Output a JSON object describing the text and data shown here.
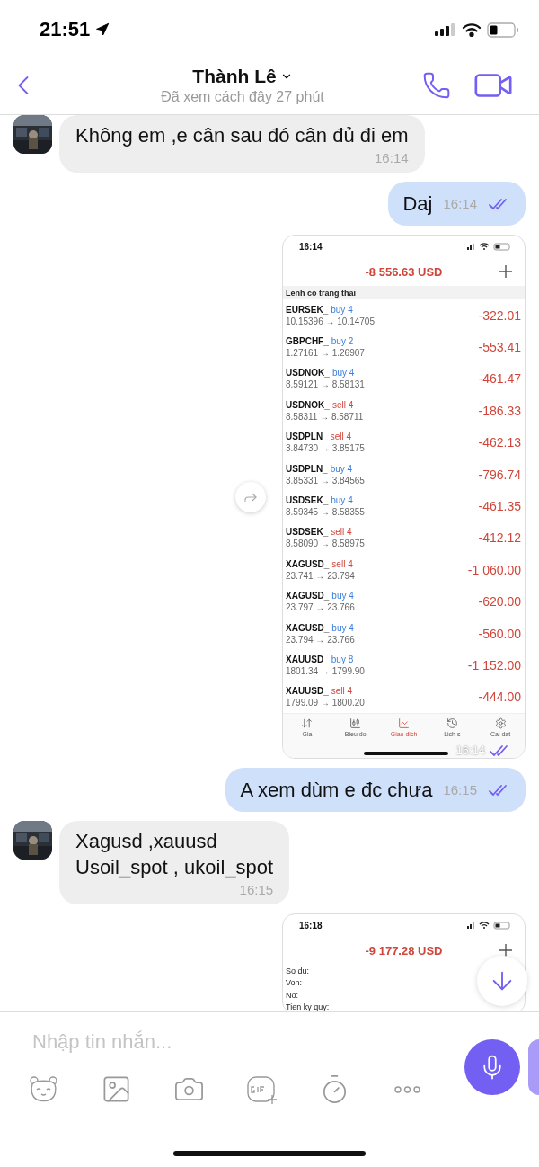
{
  "status_bar": {
    "time": "21:51"
  },
  "header": {
    "title": "Thành Lê",
    "subtitle": "Đã xem cách đây 27 phút"
  },
  "messages": [
    {
      "kind": "text",
      "incoming": true,
      "text": "Không em ,e cân sau đó cân đủ đi em",
      "time": "16:14"
    },
    {
      "kind": "text",
      "incoming": false,
      "text": "Daj",
      "time": "16:14",
      "read": true
    },
    {
      "kind": "screenshot",
      "incoming": false,
      "time": "16:14",
      "read": true,
      "share_button": true,
      "shot": {
        "time": "16:14",
        "balance": "-8 556.63 USD",
        "section": "Lenh co trang thai",
        "positions": [
          {
            "symbol": "EURSEK_",
            "order": "buy 4",
            "kind": "buy",
            "range": "10.15396 → 10.14705",
            "profit": "-322.01"
          },
          {
            "symbol": "GBPCHF_",
            "order": "buy 2",
            "kind": "buy",
            "range": "1.27161 → 1.26907",
            "profit": "-553.41"
          },
          {
            "symbol": "USDNOK_",
            "order": "buy 4",
            "kind": "buy",
            "range": "8.59121 → 8.58131",
            "profit": "-461.47"
          },
          {
            "symbol": "USDNOK_",
            "order": "sell 4",
            "kind": "sell",
            "range": "8.58311 → 8.58711",
            "profit": "-186.33"
          },
          {
            "symbol": "USDPLN_",
            "order": "sell 4",
            "kind": "sell",
            "range": "3.84730 → 3.85175",
            "profit": "-462.13"
          },
          {
            "symbol": "USDPLN_",
            "order": "buy 4",
            "kind": "buy",
            "range": "3.85331 → 3.84565",
            "profit": "-796.74"
          },
          {
            "symbol": "USDSEK_",
            "order": "buy 4",
            "kind": "buy",
            "range": "8.59345 → 8.58355",
            "profit": "-461.35"
          },
          {
            "symbol": "USDSEK_",
            "order": "sell 4",
            "kind": "sell",
            "range": "8.58090 → 8.58975",
            "profit": "-412.12"
          },
          {
            "symbol": "XAGUSD_",
            "order": "sell 4",
            "kind": "sell",
            "range": "23.741 → 23.794",
            "profit": "-1 060.00"
          },
          {
            "symbol": "XAGUSD_",
            "order": "buy 4",
            "kind": "buy",
            "range": "23.797 → 23.766",
            "profit": "-620.00"
          },
          {
            "symbol": "XAGUSD_",
            "order": "buy 4",
            "kind": "buy",
            "range": "23.794 → 23.766",
            "profit": "-560.00"
          },
          {
            "symbol": "XAUUSD_",
            "order": "buy 8",
            "kind": "buy",
            "range": "1801.34 → 1799.90",
            "profit": "-1 152.00"
          },
          {
            "symbol": "XAUUSD_",
            "order": "sell 4",
            "kind": "sell",
            "range": "1799.09 → 1800.20",
            "profit": "-444.00"
          }
        ],
        "tabs": [
          {
            "label": "Gia",
            "selected": false
          },
          {
            "label": "Bieu do",
            "selected": false
          },
          {
            "label": "Giao dich",
            "selected": true
          },
          {
            "label": "Lich s",
            "selected": false
          },
          {
            "label": "Cai dat",
            "selected": false
          }
        ]
      }
    },
    {
      "kind": "text",
      "incoming": false,
      "text": "A xem dùm e đc chưa",
      "time": "16:15",
      "read": true
    },
    {
      "kind": "text",
      "incoming": true,
      "text": "Xagusd ,xauusd\nUsoil_spot , ukoil_spot",
      "time": "16:15"
    },
    {
      "kind": "screenshot",
      "incoming": false,
      "shot": {
        "time": "16:18",
        "balance": "-9 177.28 USD",
        "fields": [
          "So du:",
          "Von:",
          "No:",
          "Tien ky quy:"
        ]
      }
    }
  ],
  "composer": {
    "placeholder": "Nhập tin nhắn..."
  }
}
